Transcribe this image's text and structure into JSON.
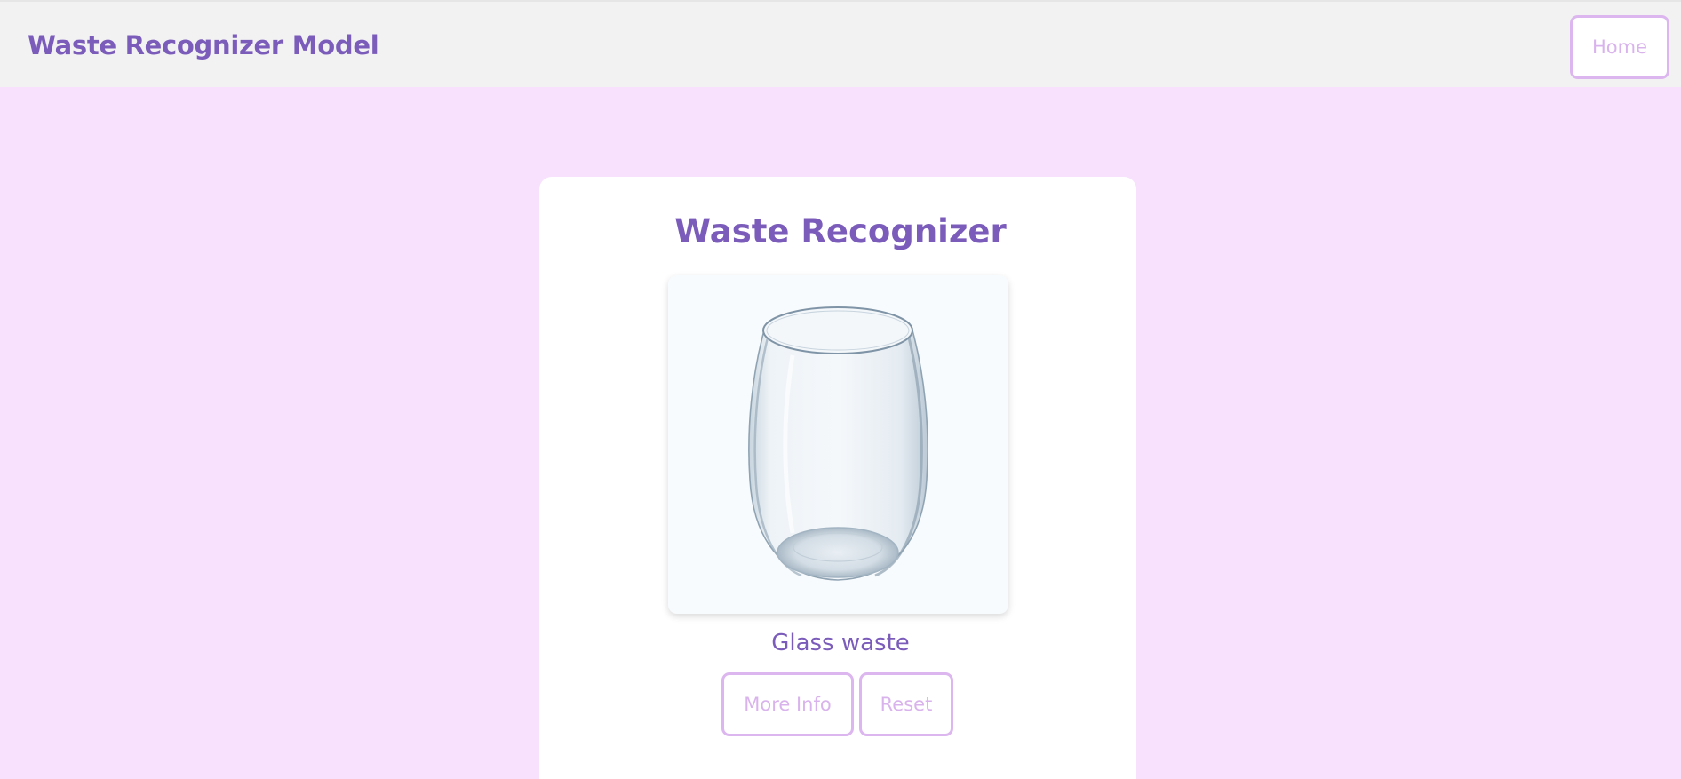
{
  "navbar": {
    "brand": "Waste Recognizer Model",
    "home_label": "Home"
  },
  "card": {
    "title": "Waste Recognizer",
    "image_icon": "glass-cup",
    "result": "Glass waste",
    "more_info_label": "More Info",
    "reset_label": "Reset"
  },
  "colors": {
    "page_background": "#f7e1fd",
    "navbar_background": "#f2f2f2",
    "accent": "#7b5cbb",
    "button_border": "#dcb6ee",
    "button_text": "#d9b4ec",
    "card_background": "#ffffff"
  }
}
